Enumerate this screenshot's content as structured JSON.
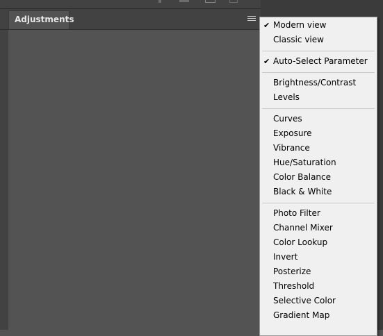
{
  "panel": {
    "tab_label": "Adjustments"
  },
  "menu": {
    "groups": [
      [
        {
          "label": "Modern view",
          "checked": true
        },
        {
          "label": "Classic view",
          "checked": false
        }
      ],
      [
        {
          "label": "Auto-Select Parameter",
          "checked": true
        }
      ],
      [
        {
          "label": "Brightness/Contrast",
          "checked": false
        },
        {
          "label": "Levels",
          "checked": false
        }
      ],
      [
        {
          "label": "Curves",
          "checked": false
        },
        {
          "label": "Exposure",
          "checked": false
        },
        {
          "label": "Vibrance",
          "checked": false
        },
        {
          "label": "Hue/Saturation",
          "checked": false
        },
        {
          "label": "Color Balance",
          "checked": false
        },
        {
          "label": "Black & White",
          "checked": false
        }
      ],
      [
        {
          "label": "Photo Filter",
          "checked": false
        },
        {
          "label": "Channel Mixer",
          "checked": false
        },
        {
          "label": "Color Lookup",
          "checked": false
        },
        {
          "label": "Invert",
          "checked": false
        },
        {
          "label": "Posterize",
          "checked": false
        },
        {
          "label": "Threshold",
          "checked": false
        },
        {
          "label": "Selective Color",
          "checked": false
        },
        {
          "label": "Gradient Map",
          "checked": false
        }
      ]
    ],
    "check_glyph": "✔"
  }
}
